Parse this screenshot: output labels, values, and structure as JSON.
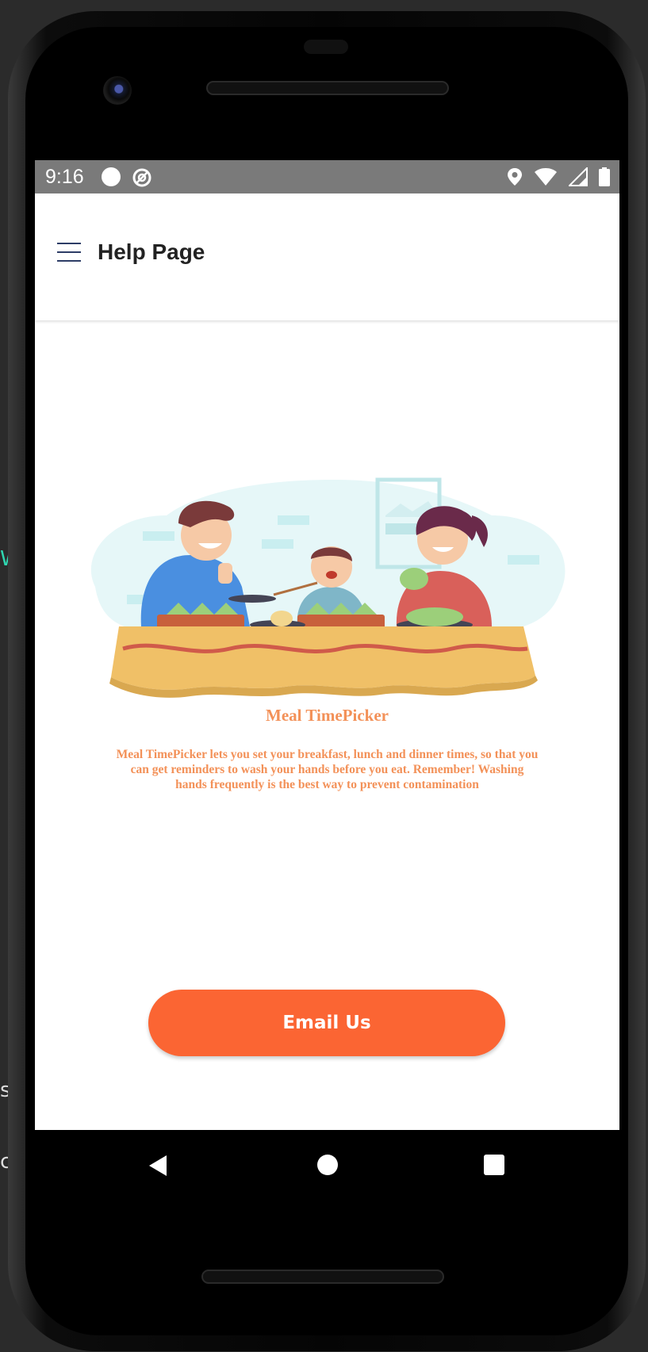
{
  "status_bar": {
    "time": "9:16",
    "icons": [
      "notification-dot-icon",
      "at-sign-icon",
      "location-icon",
      "wifi-icon",
      "signal-icon",
      "battery-icon"
    ]
  },
  "app_bar": {
    "title": "Help Page",
    "menu_icon": "hamburger-menu-icon"
  },
  "content": {
    "illustration": "family-eating-illustration",
    "app_name": "Meal TimePicker",
    "description": "Meal TimePicker lets you set your breakfast, lunch and dinner times, so that you can get reminders to wash your hands before you eat. Remember! Washing hands frequently is the best way to prevent contamination",
    "email_button_label": "Email Us"
  },
  "nav_bar": {
    "icons": [
      "back-icon",
      "home-icon",
      "recent-apps-icon"
    ]
  },
  "colors": {
    "accent": "#fb6533",
    "text_accent": "#f39158",
    "status_bar": "#7a7a7a",
    "menu_icon": "#2d3d66"
  }
}
